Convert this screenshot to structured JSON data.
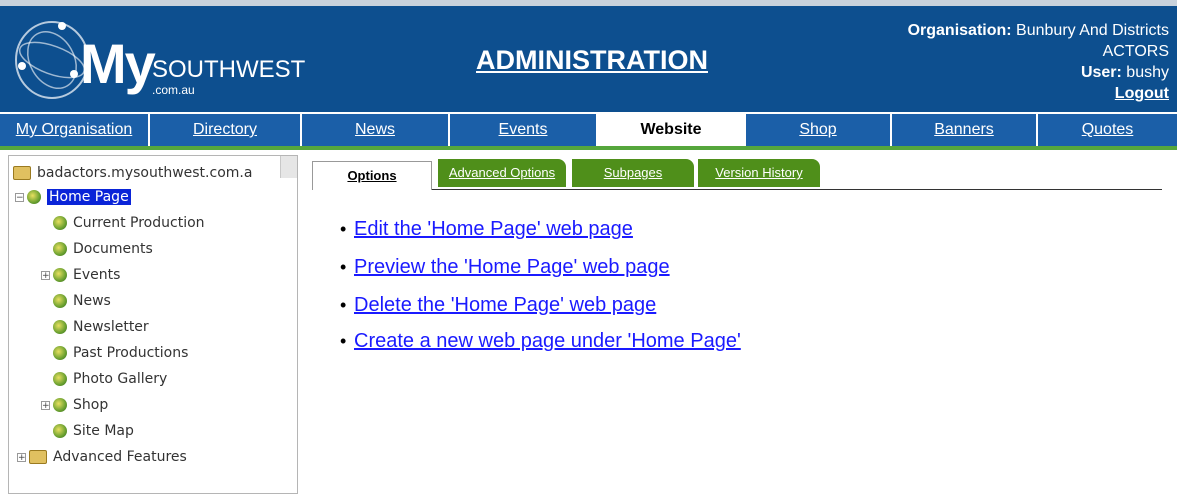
{
  "header": {
    "logo_my": "My",
    "logo_southwest": "SOUTHWEST",
    "logo_domain": ".com.au",
    "title": "ADMINISTRATION",
    "organisation_label": "Organisation:",
    "organisation_value_line1": "Bunbury And Districts",
    "organisation_value_line2": "ACTORS",
    "user_label": "User:",
    "user_value": "bushy",
    "logout_label": "Logout"
  },
  "nav": {
    "tabs": [
      {
        "label": "My Organisation"
      },
      {
        "label": "Directory"
      },
      {
        "label": "News"
      },
      {
        "label": "Events"
      },
      {
        "label": "Website"
      },
      {
        "label": "Shop"
      },
      {
        "label": "Banners"
      },
      {
        "label": "Quotes"
      }
    ],
    "active": "Website"
  },
  "tree": {
    "root_label": "badactors.mysouthwest.com.a",
    "home_label": "Home Page",
    "items": [
      {
        "label": "Current Production"
      },
      {
        "label": "Documents"
      },
      {
        "label": "Events"
      },
      {
        "label": "News"
      },
      {
        "label": "Newsletter"
      },
      {
        "label": "Past Productions"
      },
      {
        "label": "Photo Gallery"
      },
      {
        "label": "Shop"
      },
      {
        "label": "Site Map"
      }
    ],
    "advanced_label": "Advanced Features"
  },
  "content_tabs": [
    {
      "label": "Options"
    },
    {
      "label": "Advanced Options"
    },
    {
      "label": "Subpages"
    },
    {
      "label": "Version History"
    }
  ],
  "actions": [
    {
      "label": "Edit the 'Home Page' web page"
    },
    {
      "label": "Preview the 'Home Page' web page"
    },
    {
      "label": "Delete the 'Home Page' web page"
    },
    {
      "label": "Create a new web page under 'Home Page'"
    }
  ],
  "colors": {
    "header_bg": "#0d4f8f",
    "nav_tab_bg": "#1b5fa8",
    "nav_rule": "#55a63c",
    "content_tab_green": "#4f8f1a",
    "link": "#1a1aff",
    "tree_selected": "#0a24d8"
  }
}
